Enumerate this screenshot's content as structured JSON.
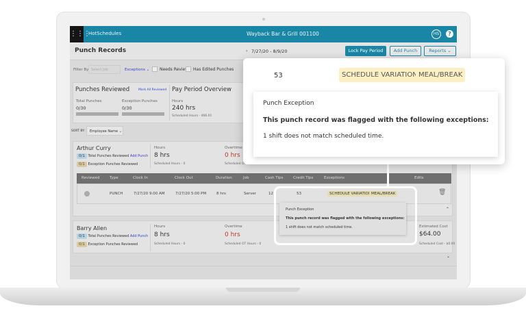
{
  "app": {
    "brand": "HotSchedules",
    "location": "Wayback Bar & Grill 001100",
    "user_initials": "HS",
    "help": "?"
  },
  "page": {
    "title": "Punch Records",
    "date_range": "7/27/20 - 8/9/20",
    "lock_label": "Lock Pay Period",
    "add_punch_label": "Add Punch",
    "reports_label": "Reports"
  },
  "filters": {
    "label": "Filter By",
    "job_placeholder": "Select Job",
    "exceptions": "Exceptions",
    "needs_review": "Needs Review",
    "has_edited": "Has Edited Punches"
  },
  "reviewed": {
    "title": "Punches Reviewed",
    "mark_all": "Mark All Reviewed",
    "total_label": "Total Punches",
    "total_value": "0/30",
    "total_progress": 0,
    "exception_label": "Exception Punches",
    "exception_value": "0/30",
    "exception_progress": 0
  },
  "overview": {
    "title": "Pay Period Overview",
    "hours_label": "Hours",
    "hours_value": "240 hrs",
    "scheduled": "Scheduled Hours - 466.01"
  },
  "sort": {
    "label": "SORT BY:",
    "value": "Employee Name"
  },
  "employees": [
    {
      "name": "Arthur Curry",
      "total": "0/1",
      "total_label": "Total Punches Reviewed",
      "add_punch": "Add Punch",
      "exc": "0/1",
      "exc_label": "Exception Punches Reviewed",
      "hours_label": "Hours",
      "hours": "8 hrs",
      "sched": "Scheduled Hours - 0",
      "ot_label": "Overtime",
      "ot": "0 hrs",
      "ot_sched": "Scheduled OT Hours - 0"
    },
    {
      "name": "Barry Allen",
      "total": "0/1",
      "total_label": "Total Punches Reviewed",
      "add_punch": "Add Punch",
      "exc": "0/1",
      "exc_label": "Exception Punches Reviewed",
      "hours_label": "Hours",
      "hours": "8 hrs",
      "sched": "Scheduled Hours - 0",
      "ot_label": "Overtime",
      "ot": "0 hrs",
      "ot_sched": "Scheduled OT Hours - 0",
      "cost_label": "Estimated Cost",
      "cost": "$64.00",
      "cost_sched": "Scheduled Cost - $0.00"
    }
  ],
  "table": {
    "headers": [
      "Reviewed",
      "Type",
      "Clock In",
      "Clock Out",
      "Duration",
      "Job",
      "Cash Tips",
      "Credit Tips",
      "Exceptions",
      "Edits"
    ],
    "row": {
      "type": "PUNCH",
      "clock_in": "7/27/20  9:00 AM",
      "clock_out": "7/27/20  5:00 PM",
      "duration": "8 hrs",
      "job": "Server",
      "cash_tips": "12",
      "credit_tips": "53",
      "exceptions": [
        "SCHEDULE VARIATION",
        "MEAL/BREAK"
      ]
    }
  },
  "popup": {
    "title": "Punch Exception",
    "heading": "This punch record was flagged with the following exceptions:",
    "detail": "1 shift does not match scheduled time."
  },
  "colors": {
    "brand": "#1a86a6",
    "exception_tag": "#fbf0c4",
    "overtime": "#c0392b"
  }
}
